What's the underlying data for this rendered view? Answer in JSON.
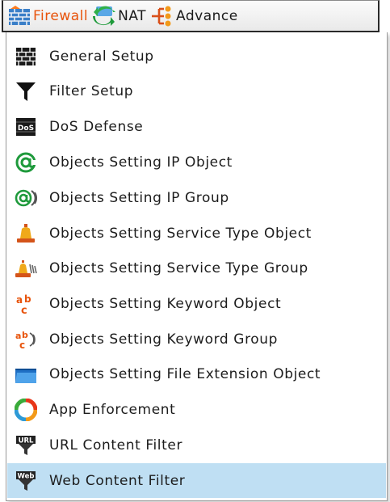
{
  "menubar": {
    "items": [
      {
        "label": "Firewall",
        "icon": "firewall-bricks-icon",
        "active": true
      },
      {
        "label": "NAT",
        "icon": "nat-arrows-icon",
        "active": false
      },
      {
        "label": "Advance",
        "icon": "advance-network-icon",
        "active": false
      }
    ]
  },
  "dropdown": {
    "items": [
      {
        "label": "General Setup",
        "icon": "brick-wall-icon"
      },
      {
        "label": "Filter Setup",
        "icon": "funnel-icon"
      },
      {
        "label": "DoS Defense",
        "icon": "dos-icon",
        "icon_text": "DoS"
      },
      {
        "label": "Objects Setting IP Object",
        "icon": "at-sign-icon"
      },
      {
        "label": "Objects Setting IP Group",
        "icon": "at-sign-group-icon"
      },
      {
        "label": "Objects Setting Service Type Object",
        "icon": "bell-icon"
      },
      {
        "label": "Objects Setting Service Type Group",
        "icon": "bell-group-icon"
      },
      {
        "label": "Objects Setting Keyword Object",
        "icon": "abc-icon",
        "icon_text": "abc"
      },
      {
        "label": "Objects Setting Keyword Group",
        "icon": "abc-group-icon",
        "icon_text": "abc"
      },
      {
        "label": "Objects Setting File Extension Object",
        "icon": "folder-icon"
      },
      {
        "label": "App Enforcement",
        "icon": "app-ring-icon"
      },
      {
        "label": "URL Content Filter",
        "icon": "url-icon",
        "icon_text": "URL"
      },
      {
        "label": "Web Content Filter",
        "icon": "web-icon",
        "icon_text": "Web",
        "highlighted": true
      }
    ]
  },
  "colors": {
    "active_menu_text": "#e8540c",
    "highlight_row": "#bfdff3"
  }
}
